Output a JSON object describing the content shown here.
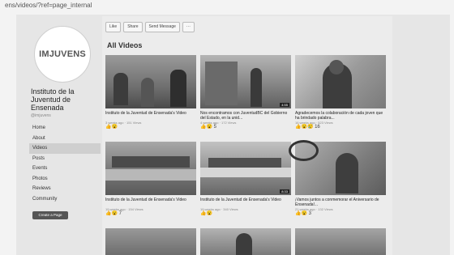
{
  "browser": {
    "url": "ens/videos/?ref=page_internal"
  },
  "sidebar": {
    "logo_text": "IMJUVENS",
    "page_name": "Instituto de la Juventud de Ensenada",
    "handle": "@imjuvens",
    "nav": [
      {
        "label": "Home"
      },
      {
        "label": "About"
      },
      {
        "label": "Videos"
      },
      {
        "label": "Posts"
      },
      {
        "label": "Events"
      },
      {
        "label": "Photos"
      },
      {
        "label": "Reviews"
      },
      {
        "label": "Community"
      }
    ],
    "create_page": "Create a Page"
  },
  "actions": [
    {
      "label": "Like"
    },
    {
      "label": "Share"
    },
    {
      "label": "Send Message"
    },
    {
      "label": "···"
    }
  ],
  "section_title": "All Videos",
  "videos": [
    {
      "title": "Instituto de la Juventud de Ensenada's Video",
      "meta": "3 weeks ago · 151 Views",
      "reactions": "👍😮",
      "duration": ""
    },
    {
      "title": "Nos encontramos con JuventudBC del Gobierno del Estado, en la unid...",
      "meta": "4 weeks ago · 172 Views",
      "reactions": "👍😮 5",
      "duration": "4:55"
    },
    {
      "title": "Agradecemos la colaboración de cada joven que ha brindado palabra...",
      "meta": "16 weeks ago · 523 Views",
      "reactions": "👍😮😢 16",
      "duration": ""
    },
    {
      "title": "Instituto de la Juventud de Ensenada's Video",
      "meta": "19 weeks ago · 154 Views",
      "reactions": "👍😮 7",
      "duration": ""
    },
    {
      "title": "Instituto de la Juventud de Ensenada's Video",
      "meta": "19 weeks ago · 340 Views",
      "reactions": "👍😮",
      "duration": "8:33"
    },
    {
      "title": "¡Vamos juntos a conmemorar el Aniversario de Ensenada!...",
      "meta": "21 weeks ago · 132 Views",
      "reactions": "👍😮 3",
      "duration": ""
    }
  ]
}
